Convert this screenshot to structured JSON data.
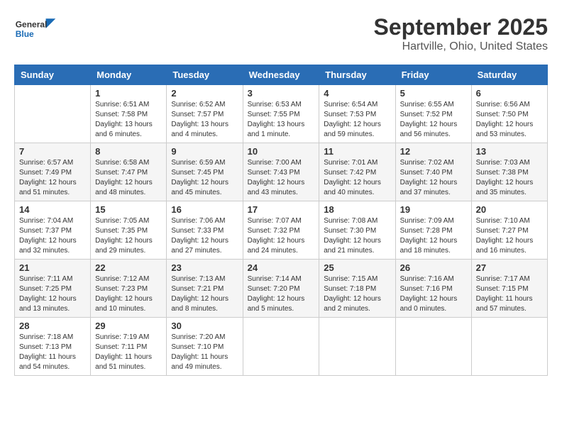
{
  "header": {
    "logo_general": "General",
    "logo_blue": "Blue",
    "month_title": "September 2025",
    "location": "Hartville, Ohio, United States"
  },
  "weekdays": [
    "Sunday",
    "Monday",
    "Tuesday",
    "Wednesday",
    "Thursday",
    "Friday",
    "Saturday"
  ],
  "weeks": [
    [
      {
        "num": "",
        "info": ""
      },
      {
        "num": "1",
        "info": "Sunrise: 6:51 AM\nSunset: 7:58 PM\nDaylight: 13 hours\nand 6 minutes."
      },
      {
        "num": "2",
        "info": "Sunrise: 6:52 AM\nSunset: 7:57 PM\nDaylight: 13 hours\nand 4 minutes."
      },
      {
        "num": "3",
        "info": "Sunrise: 6:53 AM\nSunset: 7:55 PM\nDaylight: 13 hours\nand 1 minute."
      },
      {
        "num": "4",
        "info": "Sunrise: 6:54 AM\nSunset: 7:53 PM\nDaylight: 12 hours\nand 59 minutes."
      },
      {
        "num": "5",
        "info": "Sunrise: 6:55 AM\nSunset: 7:52 PM\nDaylight: 12 hours\nand 56 minutes."
      },
      {
        "num": "6",
        "info": "Sunrise: 6:56 AM\nSunset: 7:50 PM\nDaylight: 12 hours\nand 53 minutes."
      }
    ],
    [
      {
        "num": "7",
        "info": "Sunrise: 6:57 AM\nSunset: 7:49 PM\nDaylight: 12 hours\nand 51 minutes."
      },
      {
        "num": "8",
        "info": "Sunrise: 6:58 AM\nSunset: 7:47 PM\nDaylight: 12 hours\nand 48 minutes."
      },
      {
        "num": "9",
        "info": "Sunrise: 6:59 AM\nSunset: 7:45 PM\nDaylight: 12 hours\nand 45 minutes."
      },
      {
        "num": "10",
        "info": "Sunrise: 7:00 AM\nSunset: 7:43 PM\nDaylight: 12 hours\nand 43 minutes."
      },
      {
        "num": "11",
        "info": "Sunrise: 7:01 AM\nSunset: 7:42 PM\nDaylight: 12 hours\nand 40 minutes."
      },
      {
        "num": "12",
        "info": "Sunrise: 7:02 AM\nSunset: 7:40 PM\nDaylight: 12 hours\nand 37 minutes."
      },
      {
        "num": "13",
        "info": "Sunrise: 7:03 AM\nSunset: 7:38 PM\nDaylight: 12 hours\nand 35 minutes."
      }
    ],
    [
      {
        "num": "14",
        "info": "Sunrise: 7:04 AM\nSunset: 7:37 PM\nDaylight: 12 hours\nand 32 minutes."
      },
      {
        "num": "15",
        "info": "Sunrise: 7:05 AM\nSunset: 7:35 PM\nDaylight: 12 hours\nand 29 minutes."
      },
      {
        "num": "16",
        "info": "Sunrise: 7:06 AM\nSunset: 7:33 PM\nDaylight: 12 hours\nand 27 minutes."
      },
      {
        "num": "17",
        "info": "Sunrise: 7:07 AM\nSunset: 7:32 PM\nDaylight: 12 hours\nand 24 minutes."
      },
      {
        "num": "18",
        "info": "Sunrise: 7:08 AM\nSunset: 7:30 PM\nDaylight: 12 hours\nand 21 minutes."
      },
      {
        "num": "19",
        "info": "Sunrise: 7:09 AM\nSunset: 7:28 PM\nDaylight: 12 hours\nand 18 minutes."
      },
      {
        "num": "20",
        "info": "Sunrise: 7:10 AM\nSunset: 7:27 PM\nDaylight: 12 hours\nand 16 minutes."
      }
    ],
    [
      {
        "num": "21",
        "info": "Sunrise: 7:11 AM\nSunset: 7:25 PM\nDaylight: 12 hours\nand 13 minutes."
      },
      {
        "num": "22",
        "info": "Sunrise: 7:12 AM\nSunset: 7:23 PM\nDaylight: 12 hours\nand 10 minutes."
      },
      {
        "num": "23",
        "info": "Sunrise: 7:13 AM\nSunset: 7:21 PM\nDaylight: 12 hours\nand 8 minutes."
      },
      {
        "num": "24",
        "info": "Sunrise: 7:14 AM\nSunset: 7:20 PM\nDaylight: 12 hours\nand 5 minutes."
      },
      {
        "num": "25",
        "info": "Sunrise: 7:15 AM\nSunset: 7:18 PM\nDaylight: 12 hours\nand 2 minutes."
      },
      {
        "num": "26",
        "info": "Sunrise: 7:16 AM\nSunset: 7:16 PM\nDaylight: 12 hours\nand 0 minutes."
      },
      {
        "num": "27",
        "info": "Sunrise: 7:17 AM\nSunset: 7:15 PM\nDaylight: 11 hours\nand 57 minutes."
      }
    ],
    [
      {
        "num": "28",
        "info": "Sunrise: 7:18 AM\nSunset: 7:13 PM\nDaylight: 11 hours\nand 54 minutes."
      },
      {
        "num": "29",
        "info": "Sunrise: 7:19 AM\nSunset: 7:11 PM\nDaylight: 11 hours\nand 51 minutes."
      },
      {
        "num": "30",
        "info": "Sunrise: 7:20 AM\nSunset: 7:10 PM\nDaylight: 11 hours\nand 49 minutes."
      },
      {
        "num": "",
        "info": ""
      },
      {
        "num": "",
        "info": ""
      },
      {
        "num": "",
        "info": ""
      },
      {
        "num": "",
        "info": ""
      }
    ]
  ]
}
